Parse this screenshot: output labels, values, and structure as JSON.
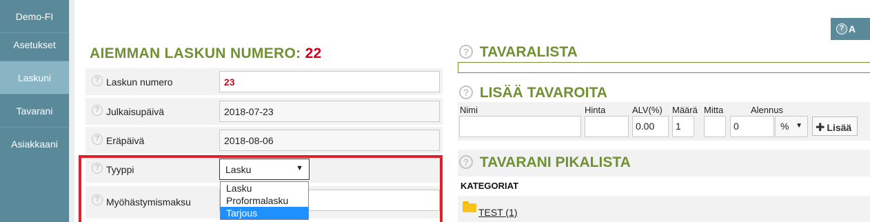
{
  "sidebar": {
    "items": [
      {
        "label": "Demo-FI"
      },
      {
        "label": "Asetukset"
      },
      {
        "label": "Laskuni"
      },
      {
        "label": "Tavarani"
      },
      {
        "label": "Asiakkaani"
      }
    ]
  },
  "top_button": {
    "label": "A"
  },
  "invoice_form": {
    "prev_title": "AIEMMAN LASKUN NUMERO:",
    "prev_number": "22",
    "rows": [
      {
        "label": "Laskun numero",
        "value": "23"
      },
      {
        "label": "Julkaisupäivä",
        "value": "2018-07-23"
      },
      {
        "label": "Eräpäivä",
        "value": "2018-08-06"
      },
      {
        "label": "Tyyppi",
        "value": "Lasku"
      },
      {
        "label": "Myöhästymismaksu",
        "value": ""
      }
    ],
    "type_options": [
      "Lasku",
      "Proformalasku",
      "Tarjous"
    ]
  },
  "product_list": {
    "title": "TAVARALISTA"
  },
  "add_products": {
    "title": "LISÄÄ TAVAROITA",
    "columns": {
      "name": "Nimi",
      "price": "Hinta",
      "vat": "ALV(%)",
      "quantity": "Määrä",
      "unit": "Mitta",
      "discount": "Alennus"
    },
    "values": {
      "name": "",
      "price": "",
      "vat": "0.00",
      "quantity": "1",
      "unit": "",
      "discount": "0",
      "discount_unit": "%"
    },
    "add_label": "Lisää"
  },
  "quick_list": {
    "title": "TAVARANI PIKALISTA",
    "categories_label": "KATEGORIAT",
    "categories": [
      {
        "label": "TEST (1)"
      }
    ]
  },
  "colors": {
    "sidebar": "#5a8a9a",
    "sidebar_active": "#88b4c4",
    "heading_green": "#6f9134",
    "invoice_number_red": "#d0021b",
    "highlight_red": "#e0202b",
    "selected_option": "#1e90ff"
  }
}
